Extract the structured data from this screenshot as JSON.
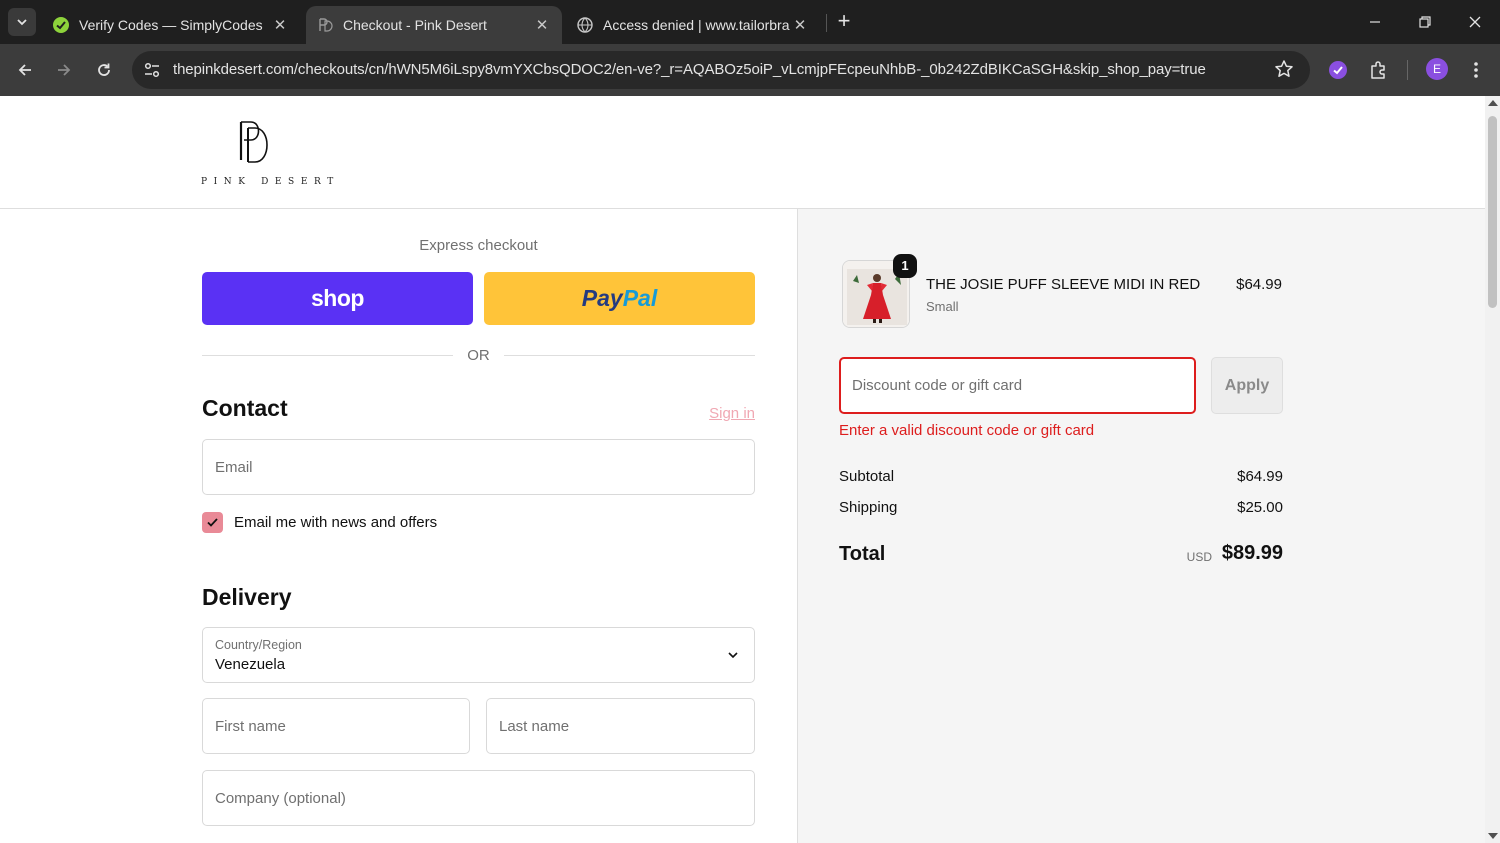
{
  "browser": {
    "tabs": [
      {
        "title": "Verify Codes — SimplyCodes",
        "icon": "simplycodes-icon"
      },
      {
        "title": "Checkout - Pink Desert",
        "icon": "pink-desert-icon",
        "active": true
      },
      {
        "title": "Access denied | www.tailorbrands.com",
        "icon": "globe-icon"
      }
    ],
    "url": "thepinkdesert.com/checkouts/cn/hWN5M6iLspy8vmYXCbsQDOC2/en-ve?_r=AQABOz5oiP_vLcmjpFEcpeuNhbB-_0b242ZdBIKCaSGH&skip_shop_pay=true",
    "profile_initial": "E"
  },
  "brand": {
    "monogram": "PD",
    "wordmark": "PINK DESERT"
  },
  "express": {
    "label": "Express checkout",
    "shop_label": "shop",
    "paypal_a": "Pay",
    "paypal_b": "Pal",
    "or": "OR"
  },
  "contact": {
    "heading": "Contact",
    "signin": "Sign in",
    "email_placeholder": "Email",
    "newsletter_label": "Email me with news and offers",
    "newsletter_checked": true
  },
  "delivery": {
    "heading": "Delivery",
    "country_label": "Country/Region",
    "country_value": "Venezuela",
    "first_name_placeholder": "First name",
    "last_name_placeholder": "Last name",
    "company_placeholder": "Company (optional)"
  },
  "summary": {
    "product": {
      "name": "THE JOSIE PUFF SLEEVE MIDI IN RED",
      "variant": "Small",
      "price": "$64.99",
      "quantity": "1"
    },
    "discount_placeholder": "Discount code or gift card",
    "apply_label": "Apply",
    "discount_error": "Enter a valid discount code or gift card",
    "subtotal_label": "Subtotal",
    "subtotal": "$64.99",
    "shipping_label": "Shipping",
    "shipping": "$25.00",
    "total_label": "Total",
    "currency": "USD",
    "total": "$89.99"
  },
  "colors": {
    "shop_purple": "#5a31f4",
    "paypal_yellow": "#ffc439",
    "error_red": "#dd1d1d",
    "accent_pink": "#e98a97"
  }
}
